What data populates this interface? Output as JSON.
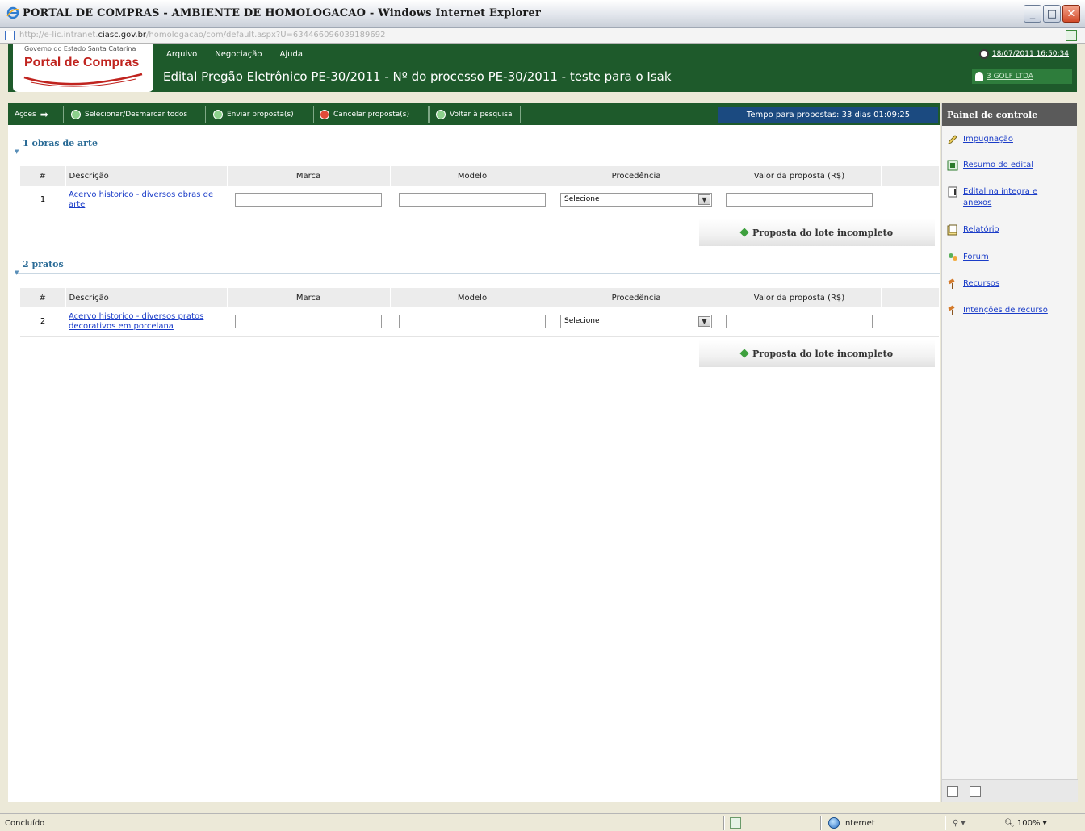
{
  "window": {
    "title": "PORTAL DE COMPRAS - AMBIENTE DE HOMOLOGACAO - Windows Internet Explorer",
    "address_prefix": "http://e-lic.intranet.",
    "address_host": "ciasc.gov.br",
    "address_suffix": "/homologacao/com/default.aspx?U=634466096039189692"
  },
  "header": {
    "logo_small": "Governo do Estado Santa Catarina",
    "logo_main": "Portal de Compras",
    "menu": [
      "Arquivo",
      "Negociação",
      "Ajuda"
    ],
    "edital_title": "Edital Pregão Eletrônico PE-30/2011 - Nº do processo PE-30/2011 - teste para o Isak",
    "datetime": "18/07/2011 16:50:34",
    "user": "3 GOLF LTDA"
  },
  "toolbar": {
    "acoes": "Ações",
    "select_all": "Selecionar/Desmarcar todos",
    "send": "Enviar proposta(s)",
    "cancel": "Cancelar proposta(s)",
    "back": "Voltar à pesquisa",
    "timer": "Tempo para propostas: 33 dias 01:09:25"
  },
  "columns": {
    "num": "#",
    "desc": "Descrição",
    "marca": "Marca",
    "modelo": "Modelo",
    "procedencia": "Procedência",
    "valor": "Valor da proposta (R$)"
  },
  "lots": [
    {
      "title": "1  obras de arte",
      "item_num": "1",
      "item_desc": "Acervo historico - diversos obras de arte",
      "select_value": "Selecione",
      "status": "Proposta do lote incompleto"
    },
    {
      "title": "2  pratos",
      "item_num": "2",
      "item_desc": "Acervo historico - diversos pratos decorativos em porcelana",
      "select_value": "Selecione",
      "status": "Proposta do lote incompleto"
    }
  ],
  "panel": {
    "title": "Painel de controle",
    "items": [
      {
        "label": "Impugnação",
        "icon": "pencil-icon"
      },
      {
        "label": "Resumo do edital",
        "icon": "document-icon"
      },
      {
        "label": "Edital na íntegra e anexos",
        "icon": "attachment-icon"
      },
      {
        "label": "Relatório",
        "icon": "report-icon"
      },
      {
        "label": "Fórum",
        "icon": "forum-icon"
      },
      {
        "label": "Recursos",
        "icon": "gavel-icon"
      },
      {
        "label": "Intenções de recurso",
        "icon": "gavel-icon"
      }
    ]
  },
  "statusbar": {
    "status": "Concluído",
    "zone": "Internet",
    "zoom": "100%"
  }
}
